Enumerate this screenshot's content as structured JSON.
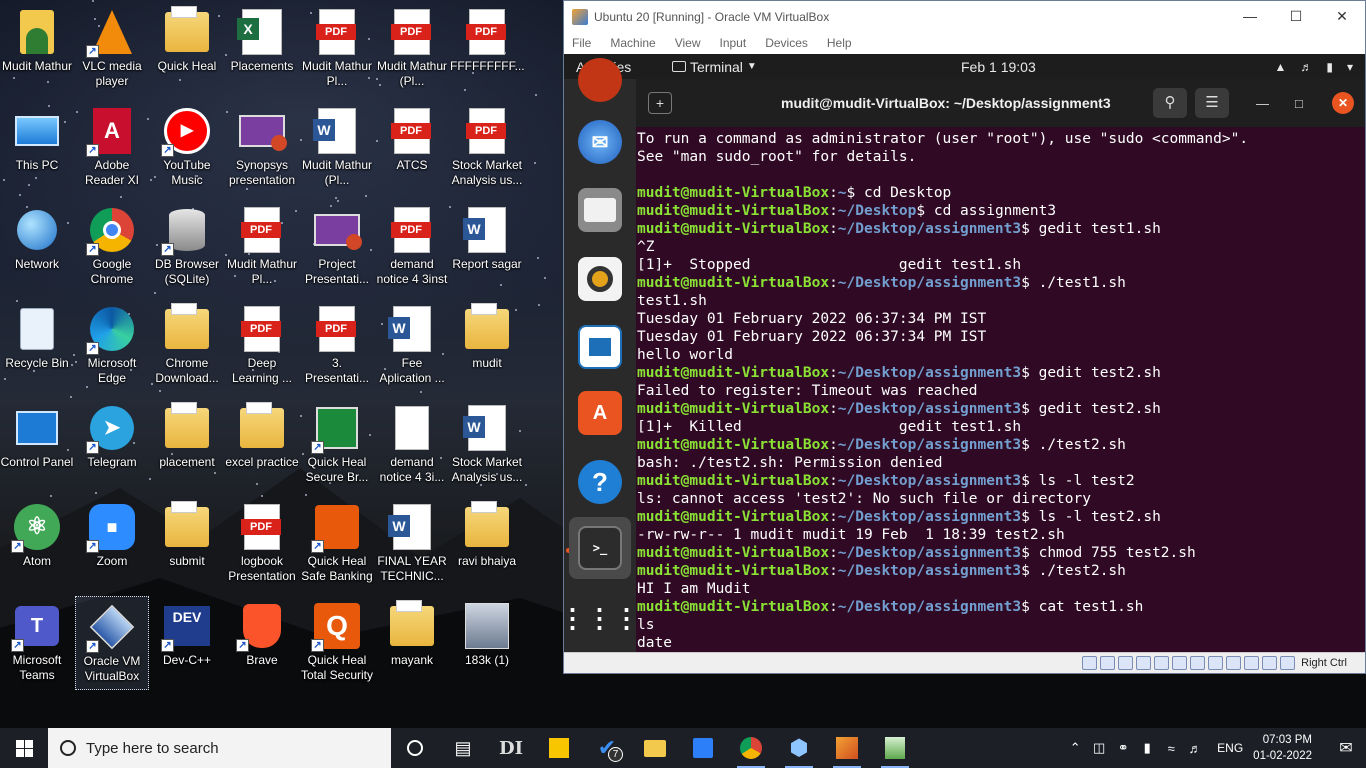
{
  "desktop": {
    "icons": [
      {
        "label": "Mudit Mathur",
        "type": "user"
      },
      {
        "label": "VLC media player",
        "type": "vlc"
      },
      {
        "label": "Quick Heal",
        "type": "folder"
      },
      {
        "label": "Placements",
        "type": "excel"
      },
      {
        "label": "Mudit Mathur Pl...",
        "type": "pdf"
      },
      {
        "label": "Mudit Mathur (Pl...",
        "type": "pdf"
      },
      {
        "label": "FFFFFFFFF...",
        "type": "pdf"
      },
      {
        "label": "This PC",
        "type": "pc"
      },
      {
        "label": "Adobe Reader XI",
        "type": "adobe"
      },
      {
        "label": "YouTube Music",
        "type": "ytmusic"
      },
      {
        "label": "Synopsys presentation",
        "type": "ppt"
      },
      {
        "label": "Mudit Mathur (Pl...",
        "type": "word"
      },
      {
        "label": "ATCS",
        "type": "pdf"
      },
      {
        "label": "Stock Market Analysis us...",
        "type": "pdf"
      },
      {
        "label": "Network",
        "type": "network"
      },
      {
        "label": "Google Chrome",
        "type": "chrome"
      },
      {
        "label": "DB Browser (SQLite)",
        "type": "db"
      },
      {
        "label": "Mudit Mathur Pl...",
        "type": "pdf"
      },
      {
        "label": "Project Presentati...",
        "type": "ppt"
      },
      {
        "label": "demand notice 4 3inst",
        "type": "pdf"
      },
      {
        "label": "Report sagar",
        "type": "word"
      },
      {
        "label": "Recycle Bin",
        "type": "recycle"
      },
      {
        "label": "Microsoft Edge",
        "type": "edge"
      },
      {
        "label": "Chrome Download...",
        "type": "folder"
      },
      {
        "label": "Deep Learning ...",
        "type": "pdf"
      },
      {
        "label": "3. Presentati...",
        "type": "pdf"
      },
      {
        "label": "Fee Aplication ...",
        "type": "word"
      },
      {
        "label": "mudit",
        "type": "folder"
      },
      {
        "label": "Control Panel",
        "type": "control"
      },
      {
        "label": "Telegram",
        "type": "telegram"
      },
      {
        "label": "placement",
        "type": "folder"
      },
      {
        "label": "excel practice",
        "type": "folder"
      },
      {
        "label": "Quick Heal Secure Br...",
        "type": "qhsb"
      },
      {
        "label": "demand notice 4 3i...",
        "type": "doc"
      },
      {
        "label": "Stock Market Analysis us...",
        "type": "word"
      },
      {
        "label": "Atom",
        "type": "atom"
      },
      {
        "label": "Zoom",
        "type": "zoom"
      },
      {
        "label": "submit",
        "type": "folder"
      },
      {
        "label": "logbook Presentation",
        "type": "pdf"
      },
      {
        "label": "Quick Heal Safe Banking",
        "type": "qhbank"
      },
      {
        "label": "FINAL YEAR TECHNIC...",
        "type": "word"
      },
      {
        "label": "ravi bhaiya",
        "type": "folder"
      },
      {
        "label": "Microsoft Teams",
        "type": "teams"
      },
      {
        "label": "Oracle VM VirtualBox",
        "type": "vbox"
      },
      {
        "label": "Dev-C++",
        "type": "devcpp"
      },
      {
        "label": "Brave",
        "type": "brave"
      },
      {
        "label": "Quick Heal Total Security",
        "type": "qhts"
      },
      {
        "label": "mayank",
        "type": "folder"
      },
      {
        "label": "183k (1)",
        "type": "photo"
      }
    ]
  },
  "vbox": {
    "title": "Ubuntu 20 [Running] - Oracle VM VirtualBox",
    "menu": [
      "File",
      "Machine",
      "View",
      "Input",
      "Devices",
      "Help"
    ],
    "host_key": "Right Ctrl"
  },
  "ubuntu": {
    "activities": "Activities",
    "app_menu": "Terminal",
    "clock": "Feb 1  19:03",
    "terminal_title": "mudit@mudit-VirtualBox: ~/Desktop/assignment3",
    "user": "mudit@mudit-VirtualBox",
    "lines": [
      {
        "kind": "out",
        "text": "To run a command as administrator (user \"root\"), use \"sudo <command>\"."
      },
      {
        "kind": "out",
        "text": "See \"man sudo_root\" for details."
      },
      {
        "kind": "out",
        "text": ""
      },
      {
        "kind": "prompt",
        "path": "~",
        "cmd": "$ cd Desktop"
      },
      {
        "kind": "prompt",
        "path": "~/Desktop",
        "cmd": "$ cd assignment3"
      },
      {
        "kind": "prompt",
        "path": "~/Desktop/assignment3",
        "cmd": "$ gedit test1.sh"
      },
      {
        "kind": "out",
        "text": "^Z"
      },
      {
        "kind": "out",
        "text": "[1]+  Stopped                 gedit test1.sh"
      },
      {
        "kind": "prompt",
        "path": "~/Desktop/assignment3",
        "cmd": "$ ./test1.sh"
      },
      {
        "kind": "out",
        "text": "test1.sh"
      },
      {
        "kind": "out",
        "text": "Tuesday 01 February 2022 06:37:34 PM IST"
      },
      {
        "kind": "out",
        "text": "Tuesday 01 February 2022 06:37:34 PM IST"
      },
      {
        "kind": "out",
        "text": "hello world"
      },
      {
        "kind": "prompt",
        "path": "~/Desktop/assignment3",
        "cmd": "$ gedit test2.sh"
      },
      {
        "kind": "out",
        "text": "Failed to register: Timeout was reached"
      },
      {
        "kind": "prompt",
        "path": "~/Desktop/assignment3",
        "cmd": "$ gedit test2.sh"
      },
      {
        "kind": "out",
        "text": "[1]+  Killed                  gedit test1.sh"
      },
      {
        "kind": "prompt",
        "path": "~/Desktop/assignment3",
        "cmd": "$ ./test2.sh"
      },
      {
        "kind": "out",
        "text": "bash: ./test2.sh: Permission denied"
      },
      {
        "kind": "prompt",
        "path": "~/Desktop/assignment3",
        "cmd": "$ ls -l test2"
      },
      {
        "kind": "out",
        "text": "ls: cannot access 'test2': No such file or directory"
      },
      {
        "kind": "prompt",
        "path": "~/Desktop/assignment3",
        "cmd": "$ ls -l test2.sh"
      },
      {
        "kind": "out",
        "text": "-rw-rw-r-- 1 mudit mudit 19 Feb  1 18:39 test2.sh"
      },
      {
        "kind": "prompt",
        "path": "~/Desktop/assignment3",
        "cmd": "$ chmod 755 test2.sh"
      },
      {
        "kind": "prompt",
        "path": "~/Desktop/assignment3",
        "cmd": "$ ./test2.sh"
      },
      {
        "kind": "out",
        "text": "HI I am Mudit"
      },
      {
        "kind": "prompt",
        "path": "~/Desktop/assignment3",
        "cmd": "$ cat test1.sh"
      },
      {
        "kind": "out",
        "text": "ls"
      },
      {
        "kind": "out",
        "text": "date"
      }
    ]
  },
  "taskbar": {
    "search_placeholder": "Type here to search",
    "badge_count": "7",
    "language": "ENG",
    "time": "07:03 PM",
    "date": "01-02-2022"
  }
}
